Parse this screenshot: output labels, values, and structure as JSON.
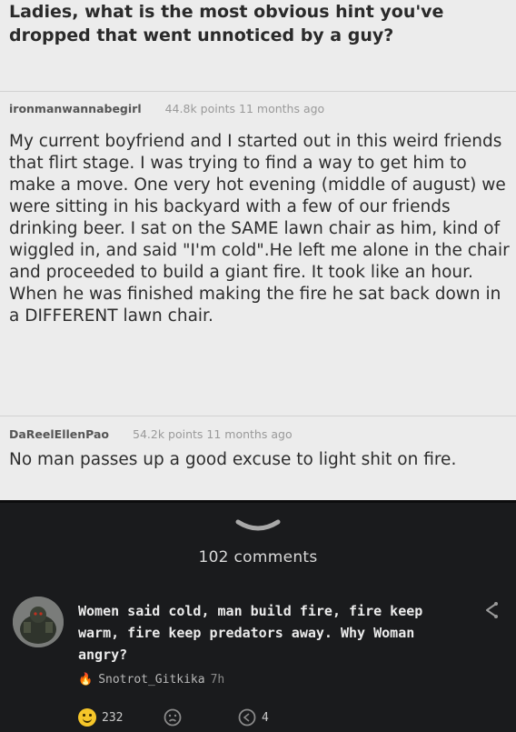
{
  "post": {
    "title": "Ladies, what is the most obvious hint you've dropped that went unnoticed by a guy?",
    "comment1": {
      "username": "ironmanwannabegirl",
      "meta": "44.8k points 11 months ago",
      "body": "My current boyfriend and I started out in this weird friends that flirt stage. I was trying to find a way to get him to make a move. One very hot evening (middle of august) we were sitting in his backyard with a few of our friends drinking beer. I sat on the SAME lawn chair as him, kind of wiggled in, and said \"I'm cold\".He left me alone in the chair and proceeded to build a giant fire. It took like an hour. When he was finished making the fire he sat back down in a DIFFERENT lawn chair."
    },
    "comment2": {
      "username": "DaReelEllenPao",
      "meta": "54.2k points 11 months ago",
      "body": "No man passes up a good excuse to light shit on fire."
    }
  },
  "comments_section": {
    "count_label": "102 comments",
    "top_comment": {
      "text": "Women said cold, man build fire, fire keep warm, fire keep predators away. Why Woman angry?",
      "author": "Snotrot_Gitkika",
      "time": "7h",
      "reactions": {
        "happy_count": "232",
        "reply_count": "4"
      }
    }
  },
  "colors": {
    "post_bg": "#ececec",
    "dark_bg": "#1a1b1d",
    "reaction_yellow": "#f6c629",
    "flame": "#f3a325"
  },
  "icons": [
    "chevron-down-icon",
    "avatar",
    "share-icon",
    "flame-icon",
    "happy-reaction-icon",
    "sad-reaction-icon",
    "reply-icon"
  ]
}
